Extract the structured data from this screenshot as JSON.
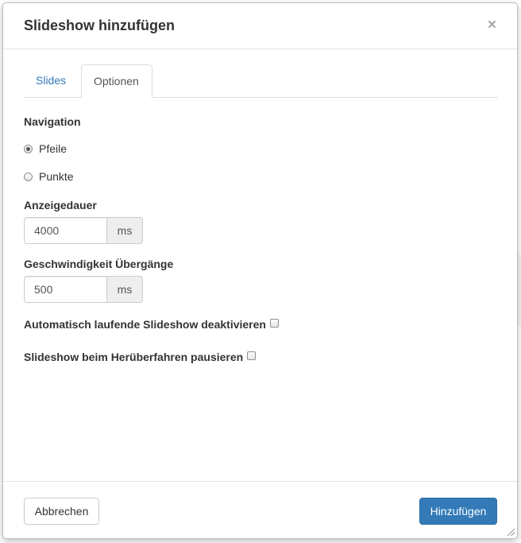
{
  "dialog": {
    "title": "Slideshow hinzufügen",
    "close_glyph": "×"
  },
  "tabs": [
    {
      "label": "Slides",
      "active": false
    },
    {
      "label": "Optionen",
      "active": true
    }
  ],
  "options": {
    "navigation": {
      "label": "Navigation",
      "choices": [
        {
          "label": "Pfeile",
          "selected": true
        },
        {
          "label": "Punkte",
          "selected": false
        }
      ]
    },
    "duration": {
      "label": "Anzeigedauer",
      "value": "4000",
      "unit": "ms"
    },
    "transition_speed": {
      "label": "Geschwindigkeit Übergänge",
      "value": "500",
      "unit": "ms"
    },
    "disable_autoplay": {
      "label": "Automatisch laufende Slideshow deaktivieren",
      "checked": false
    },
    "pause_on_hover": {
      "label": "Slideshow beim Herüberfahren pausieren",
      "checked": false
    }
  },
  "footer": {
    "cancel_label": "Abbrechen",
    "submit_label": "Hinzufügen"
  },
  "colors": {
    "primary": "#337ab7",
    "link": "#337ab7",
    "addon_bg": "#eeeeee"
  }
}
